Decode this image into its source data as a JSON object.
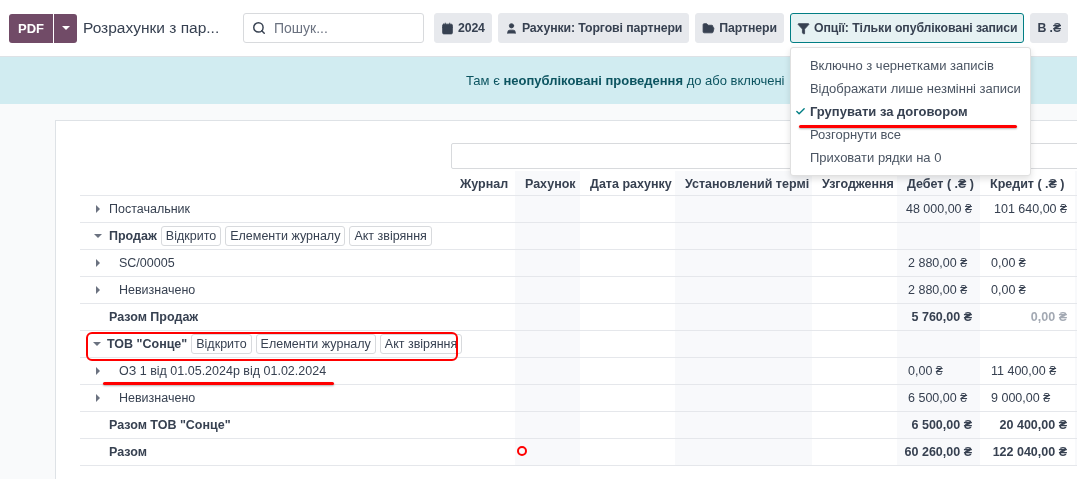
{
  "toolbar": {
    "pdf_button": "PDF",
    "title": "Розрахунки з пар...",
    "search": {
      "placeholder": "Пошук..."
    },
    "filters": [
      {
        "kind": "calendar",
        "label": "2024",
        "selected": false
      },
      {
        "kind": "user",
        "label": "Рахунки: Торгові партнери",
        "selected": false
      },
      {
        "kind": "folder",
        "label": "Партнери",
        "selected": false
      },
      {
        "kind": "filter",
        "label": "Опції: Тільки опубліковані записи",
        "selected": true
      },
      {
        "kind": "plain",
        "label": "В .₴",
        "selected": false
      }
    ]
  },
  "options_menu": {
    "items": [
      {
        "label": "Включно з чернетками записів",
        "checked": false,
        "marked": false
      },
      {
        "label": "Відображати лише незмінні записи",
        "checked": false,
        "marked": false
      },
      {
        "label": "Групувати за договором",
        "checked": true,
        "marked": true
      },
      {
        "label": "Розгорнути все",
        "checked": false,
        "marked": false
      },
      {
        "label": "Приховати рядки на 0",
        "checked": false,
        "marked": false
      }
    ]
  },
  "banner": {
    "text": "Там є **неопубліковані проведення** до або включені"
  },
  "table": {
    "columns": [
      "Журнал",
      "Рахунок",
      "Дата рахунку",
      "Установлений термі",
      "Узгодження",
      "Дебет ( .₴ )",
      "Кредит ( .₴ )"
    ],
    "rows": [
      {
        "kind": "group",
        "label": "Постачальник",
        "expanded": false,
        "debit": "48 000,00 ₴",
        "credit": "101 640,00 ₴"
      },
      {
        "kind": "group",
        "label": "Продаж",
        "expanded": true,
        "actions": [
          "Відкрито",
          "Елементи журналу",
          "Акт звіряння"
        ]
      },
      {
        "kind": "line",
        "label": "SC/00005",
        "expanded": false,
        "debit": "2 880,00 ₴",
        "credit": "0,00 ₴"
      },
      {
        "kind": "line",
        "label": "Невизначено",
        "expanded": false,
        "debit": "2 880,00 ₴",
        "credit": "0,00 ₴"
      },
      {
        "kind": "subtotal",
        "label": "Разом Продаж",
        "debit": "5 760,00 ₴",
        "credit": "0,00 ₴",
        "credit_muted": true
      },
      {
        "kind": "group",
        "label": "ТОВ \"Сонце\"",
        "expanded": true,
        "actions": [
          "Відкрито",
          "Елементи журналу",
          "Акт звіряння"
        ],
        "marked": true
      },
      {
        "kind": "line",
        "label": "ОЗ 1 від 01.05.2024р від 01.02.2024",
        "expanded": false,
        "debit": "0,00 ₴",
        "credit": "11 400,00 ₴",
        "marked": true
      },
      {
        "kind": "line",
        "label": "Невизначено",
        "expanded": false,
        "debit": "6 500,00 ₴",
        "credit": "9 000,00 ₴"
      },
      {
        "kind": "subtotal",
        "label": "Разом ТОВ \"Сонце\"",
        "debit": "6 500,00 ₴",
        "credit": "20 400,00 ₴",
        "credit_muted": false
      },
      {
        "kind": "total",
        "label": "Разом",
        "debit": "60 260,00 ₴",
        "credit": "122 040,00 ₴",
        "circled": true
      }
    ]
  }
}
